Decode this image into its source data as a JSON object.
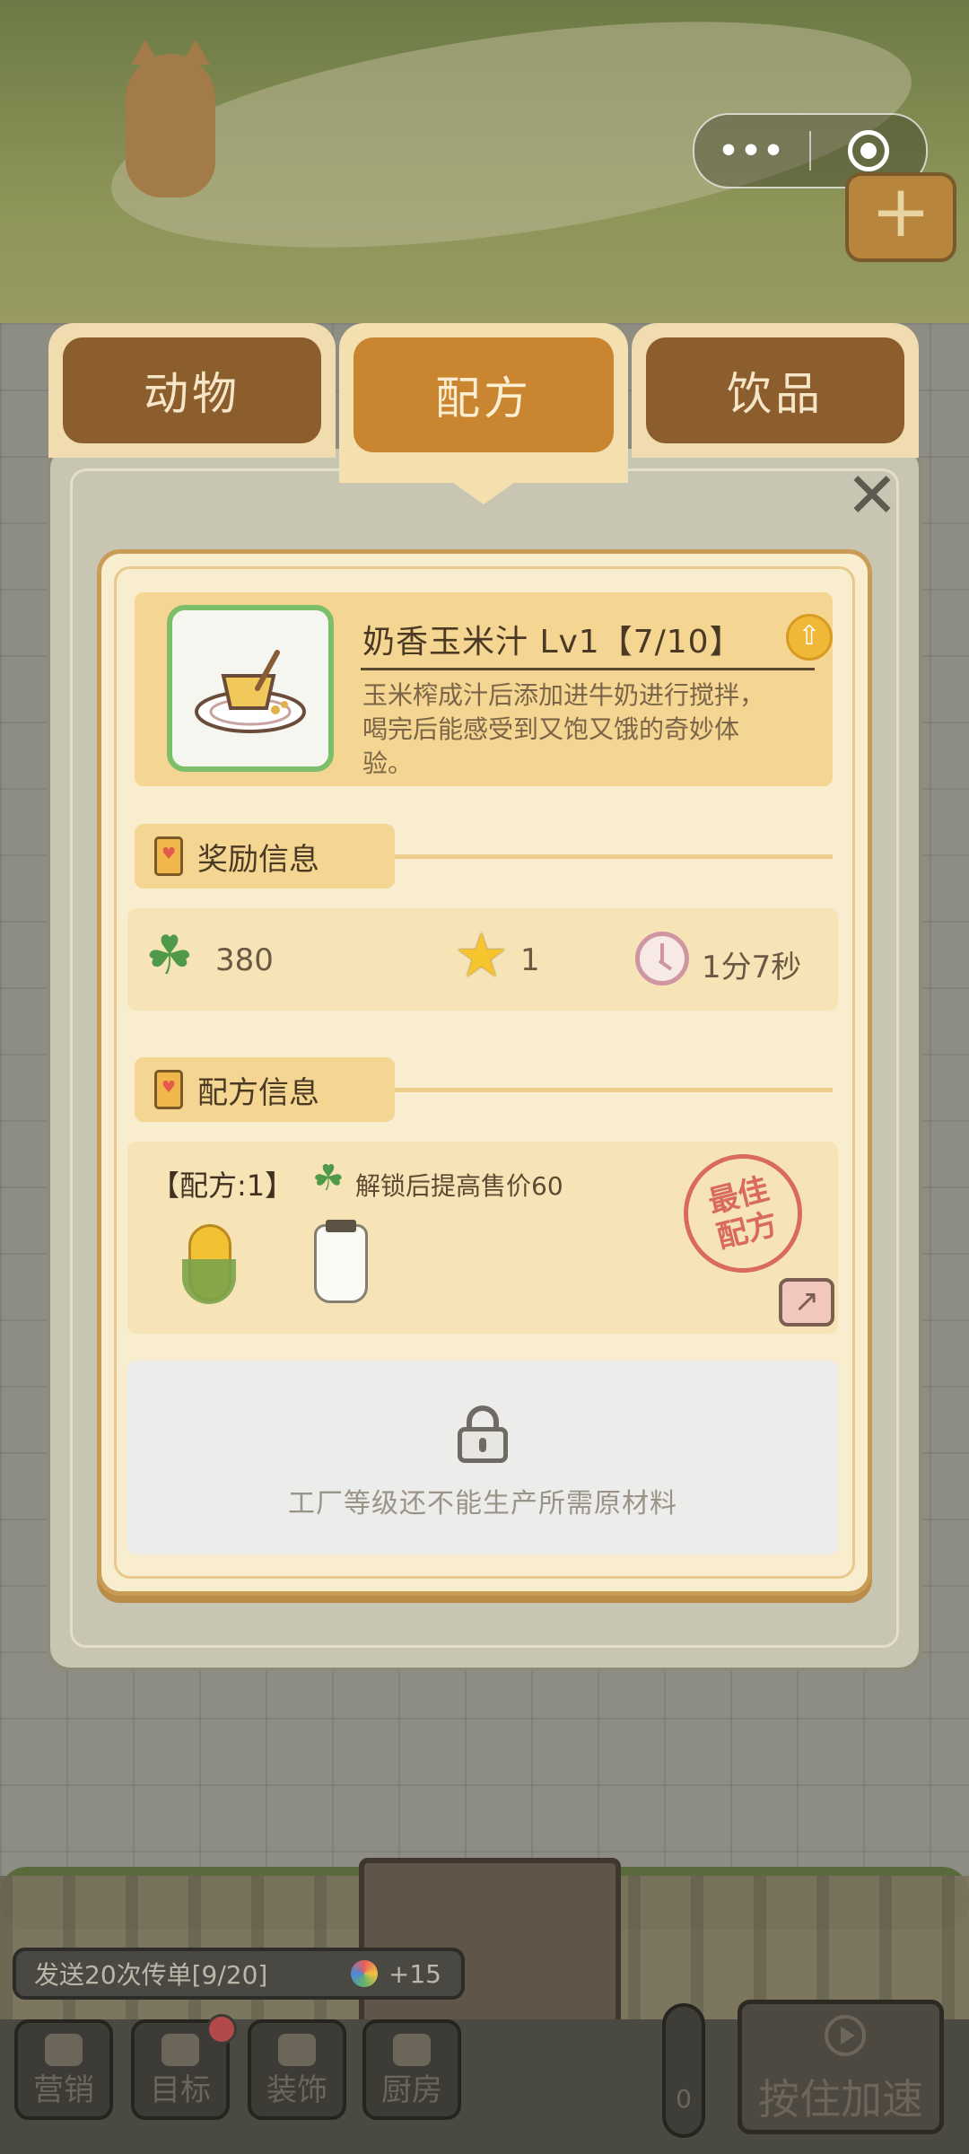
{
  "capsule": {
    "more_icon": "more-dots-icon",
    "close_icon": "target-circle-icon"
  },
  "tabs": [
    {
      "label": "动物",
      "active": false
    },
    {
      "label": "配方",
      "active": true
    },
    {
      "label": "饮品",
      "active": false
    }
  ],
  "dialog": {
    "item": {
      "title": "奶香玉米汁 Lv1【7/10】",
      "description": "玉米榨成汁后添加进牛奶进行搅拌，喝完后能感受到又饱又饿的奇妙体验。"
    },
    "reward_section": {
      "label": "奖励信息",
      "clover_value": "380",
      "star_value": "1",
      "time_value": "1分7秒"
    },
    "recipe_section": {
      "label": "配方信息",
      "recipe_name": "【配方:1】",
      "bonus_text": "解锁后提高售价60",
      "ingredients": [
        "corn-icon",
        "milk-bottle-icon"
      ],
      "stamp_text_1": "最佳",
      "stamp_text_2": "配方"
    },
    "lock_text": "工厂等级还不能生产所需原材料"
  },
  "hud": {
    "task_text": "发送20次传单[9/20]",
    "task_reward": "+15",
    "buttons": [
      "营销",
      "目标",
      "装饰",
      "厨房"
    ],
    "thermo_value": "0",
    "speed_label": "按住加速"
  },
  "colors": {
    "tab_active": "#c9852f",
    "tab_inactive": "#8d5e2d",
    "dialog_bg": "#f8edcf",
    "section_bg": "#f4d592",
    "clover": "#4f9a4a",
    "stamp": "#d96b5c"
  }
}
